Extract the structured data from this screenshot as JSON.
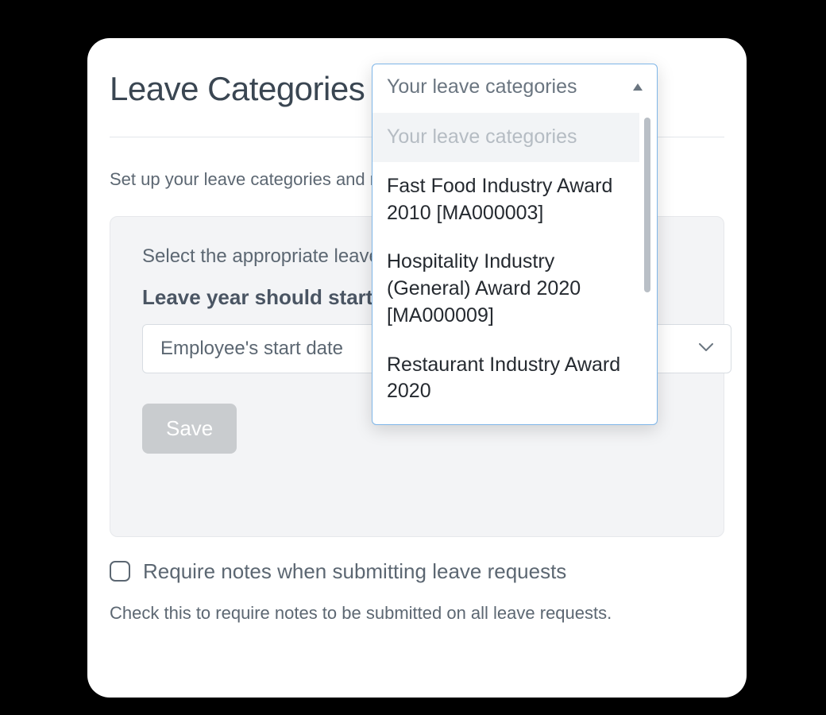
{
  "page": {
    "title": "Leave Categories",
    "intro_text": "Set up your leave categories and                                                   matically, w",
    "panel": {
      "desc": "Select the appropriate leave                                                                  odown list.",
      "leave_year_label": "Leave year should start o",
      "start_select_value": "Employee's start date",
      "save_label": "Save"
    },
    "require_notes_label": "Require notes when submitting leave requests",
    "help_text": "Check this to require notes to be submitted on all leave requests."
  },
  "dropdown": {
    "selected_label": "Your leave categories",
    "placeholder_label": "Your leave categories",
    "options": [
      "Fast Food Industry Award 2010 [MA000003]",
      "Hospitality Industry (General) Award 2020 [MA000009]",
      "Restaurant Industry Award 2020"
    ]
  }
}
